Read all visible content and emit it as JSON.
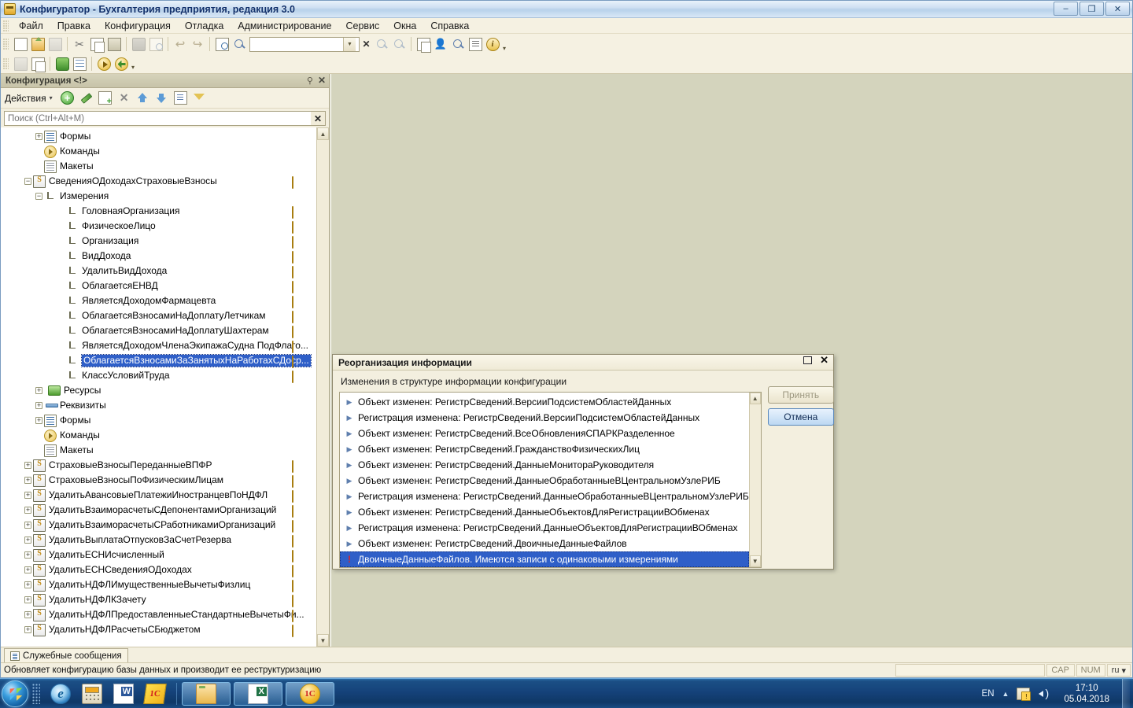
{
  "window": {
    "title": "Конфигуратор - Бухгалтерия предприятия, редакция 3.0",
    "minimize": "–",
    "restore": "❐",
    "close": "✕"
  },
  "menubar": {
    "items": [
      "Файл",
      "Правка",
      "Конфигурация",
      "Отладка",
      "Администрирование",
      "Сервис",
      "Окна",
      "Справка"
    ]
  },
  "toolbar": {
    "search_value": "",
    "search_placeholder": "",
    "row1_icons": [
      "new-document-icon",
      "open-folder-icon",
      "save-icon",
      "cut-icon",
      "copy-icon",
      "paste-icon",
      "print-icon",
      "print-preview-icon",
      "undo-icon",
      "redo-icon",
      "find-icon",
      "magnifier-icon",
      "clear-search-icon",
      "find-prev-icon",
      "find-next-icon",
      "copy-window-icon",
      "user-icon",
      "syntax-help-icon",
      "journal-icon",
      "info-icon"
    ],
    "row2_icons": [
      "blank-icon",
      "close-all-icon",
      "database-icon",
      "table-icon",
      "start-debug-icon",
      "start-debug-fast-icon"
    ]
  },
  "config_panel": {
    "caption": "Конфигурация <!>",
    "pin_icon": "pin-icon",
    "close_icon": "close-icon",
    "actions_label": "Действия",
    "search_placeholder": "Поиск (Ctrl+Alt+M)",
    "search_value": "",
    "search_clear": "✕",
    "action_icons": [
      "add-icon",
      "edit-icon",
      "copy-icon",
      "delete-icon",
      "move-up-icon",
      "move-down-icon",
      "list-icon",
      "filter-icon"
    ],
    "tree": [
      {
        "label": "Формы",
        "indent": 3,
        "expander": "+",
        "icon": "form-icon",
        "bead": false
      },
      {
        "label": "Команды",
        "indent": 3,
        "expander": "",
        "icon": "command-icon",
        "bead": false
      },
      {
        "label": "Макеты",
        "indent": 3,
        "expander": "",
        "icon": "layout-icon",
        "bead": false
      },
      {
        "label": "СведенияОДоходахСтраховыеВзносы",
        "indent": 2,
        "expander": "−",
        "icon": "register-icon",
        "bead": true
      },
      {
        "label": "Измерения",
        "indent": 3,
        "expander": "−",
        "icon": "dimension-icon",
        "bead": false
      },
      {
        "label": "ГоловнаяОрганизация",
        "indent": 5,
        "expander": "",
        "icon": "dimension-icon",
        "bead": true
      },
      {
        "label": "ФизическоеЛицо",
        "indent": 5,
        "expander": "",
        "icon": "dimension-icon",
        "bead": true
      },
      {
        "label": "Организация",
        "indent": 5,
        "expander": "",
        "icon": "dimension-icon",
        "bead": true
      },
      {
        "label": "ВидДохода",
        "indent": 5,
        "expander": "",
        "icon": "dimension-icon",
        "bead": true
      },
      {
        "label": "УдалитьВидДохода",
        "indent": 5,
        "expander": "",
        "icon": "dimension-icon",
        "bead": true
      },
      {
        "label": "ОблагаетсяЕНВД",
        "indent": 5,
        "expander": "",
        "icon": "dimension-icon",
        "bead": true
      },
      {
        "label": "ЯвляетсяДоходомФармацевта",
        "indent": 5,
        "expander": "",
        "icon": "dimension-icon",
        "bead": true
      },
      {
        "label": "ОблагаетсяВзносамиНаДоплатуЛетчикам",
        "indent": 5,
        "expander": "",
        "icon": "dimension-icon",
        "bead": true
      },
      {
        "label": "ОблагаетсяВзносамиНаДоплатуШахтерам",
        "indent": 5,
        "expander": "",
        "icon": "dimension-icon",
        "bead": true
      },
      {
        "label": "ЯвляетсяДоходомЧленаЭкипажаСудна ПодФлаго...",
        "indent": 5,
        "expander": "",
        "icon": "dimension-icon",
        "bead": true
      },
      {
        "label": "ОблагаетсяВзносамиЗаЗанятыхНаРаботахСДоср...",
        "indent": 5,
        "expander": "",
        "icon": "dimension-icon",
        "bead": true,
        "selected": true
      },
      {
        "label": "КлассУсловийТруда",
        "indent": 5,
        "expander": "",
        "icon": "dimension-icon",
        "bead": true
      },
      {
        "label": "Ресурсы",
        "indent": 3,
        "expander": "+",
        "icon": "resource-icon",
        "bead": false
      },
      {
        "label": "Реквизиты",
        "indent": 3,
        "expander": "+",
        "icon": "attribute-icon",
        "bead": false
      },
      {
        "label": "Формы",
        "indent": 3,
        "expander": "+",
        "icon": "form-icon",
        "bead": false
      },
      {
        "label": "Команды",
        "indent": 3,
        "expander": "",
        "icon": "command-icon",
        "bead": false
      },
      {
        "label": "Макеты",
        "indent": 3,
        "expander": "",
        "icon": "layout-icon",
        "bead": false
      },
      {
        "label": "СтраховыеВзносыПереданныеВПФР",
        "indent": 2,
        "expander": "+",
        "icon": "register-icon",
        "bead": true
      },
      {
        "label": "СтраховыеВзносыПоФизическимЛицам",
        "indent": 2,
        "expander": "+",
        "icon": "register-icon",
        "bead": true
      },
      {
        "label": "УдалитьАвансовыеПлатежиИностранцевПоНДФЛ",
        "indent": 2,
        "expander": "+",
        "icon": "register-icon",
        "bead": true
      },
      {
        "label": "УдалитьВзаиморасчетыСДепонентамиОрганизаций",
        "indent": 2,
        "expander": "+",
        "icon": "register-icon",
        "bead": true
      },
      {
        "label": "УдалитьВзаиморасчетыСРаботникамиОрганизаций",
        "indent": 2,
        "expander": "+",
        "icon": "register-icon",
        "bead": true
      },
      {
        "label": "УдалитьВыплатаОтпусковЗаСчетРезерва",
        "indent": 2,
        "expander": "+",
        "icon": "register-icon",
        "bead": true
      },
      {
        "label": "УдалитьЕСНИсчисленный",
        "indent": 2,
        "expander": "+",
        "icon": "register-icon",
        "bead": true
      },
      {
        "label": "УдалитьЕСНСведенияОДоходах",
        "indent": 2,
        "expander": "+",
        "icon": "register-icon",
        "bead": true
      },
      {
        "label": "УдалитьНДФЛИмущественныеВычетыФизлиц",
        "indent": 2,
        "expander": "+",
        "icon": "register-icon",
        "bead": true
      },
      {
        "label": "УдалитьНДФЛКЗачету",
        "indent": 2,
        "expander": "+",
        "icon": "register-icon",
        "bead": true
      },
      {
        "label": "УдалитьНДФЛПредоставленныеСтандартныеВычетыФи...",
        "indent": 2,
        "expander": "+",
        "icon": "register-icon",
        "bead": true
      },
      {
        "label": "УдалитьНДФЛРасчетыСБюджетом",
        "indent": 2,
        "expander": "+",
        "icon": "register-icon",
        "bead": true
      }
    ]
  },
  "dialog": {
    "title": "Реорганизация информации",
    "maximize_icon": "maximize-icon",
    "close_icon": "close-icon",
    "subtitle": "Изменения в структуре информации конфигурации",
    "accept_label": "Принять",
    "cancel_label": "Отмена",
    "items": [
      {
        "text": "Объект изменен: РегистрСведений.ВерсииПодсистемОбластейДанных",
        "warn": false
      },
      {
        "text": "Регистрация изменена: РегистрСведений.ВерсииПодсистемОбластейДанных",
        "warn": false
      },
      {
        "text": "Объект изменен: РегистрСведений.ВсеОбновленияСПАРКРазделенное",
        "warn": false
      },
      {
        "text": "Объект изменен: РегистрСведений.ГражданствоФизическихЛиц",
        "warn": false
      },
      {
        "text": "Объект изменен: РегистрСведений.ДанныеМонитораРуководителя",
        "warn": false
      },
      {
        "text": "Объект изменен: РегистрСведений.ДанныеОбработанныеВЦентральномУзлеРИБ",
        "warn": false
      },
      {
        "text": "Регистрация изменена: РегистрСведений.ДанныеОбработанныеВЦентральномУзлеРИБ",
        "warn": false
      },
      {
        "text": "Объект изменен: РегистрСведений.ДанныеОбъектовДляРегистрацииВОбменах",
        "warn": false
      },
      {
        "text": "Регистрация изменена: РегистрСведений.ДанныеОбъектовДляРегистрацииВОбменах",
        "warn": false
      },
      {
        "text": "Объект изменен: РегистрСведений.ДвоичныеДанныеФайлов",
        "warn": false
      },
      {
        "text": "ДвоичныеДанныеФайлов. Имеются записи с одинаковыми измерениями",
        "warn": true,
        "selected": true
      }
    ]
  },
  "messages_panel": {
    "tab_label": "Служебные сообщения",
    "tab_icon": "messages-icon"
  },
  "statusbar": {
    "text": "Обновляет конфигурацию базы данных и производит ее реструктуризацию",
    "cap": "CAP",
    "num": "NUM",
    "lang": "ru",
    "lang_caret": "▾"
  },
  "taskbar": {
    "start_icon": "windows-start-icon",
    "quick_launch": [
      "internet-explorer-icon",
      "calculator-icon",
      "word-icon",
      "onec-v7-icon"
    ],
    "task_buttons": [
      "folder-window-icon",
      "excel-window-icon",
      "onec-window-icon"
    ],
    "tray": {
      "language": "EN",
      "show_hidden_icon": "chevron-up-icon",
      "action_center_icon": "action-center-warning-icon",
      "volume_icon": "volume-icon",
      "time": "17:10",
      "date": "05.04.2018"
    }
  },
  "colors": {
    "window_bg": "#f3efdf",
    "workspace_bg": "#d4d4bd",
    "selection_blue": "#2f5fc8",
    "titlebar_text": "#11306b",
    "taskbar_blue": "#15427a"
  }
}
